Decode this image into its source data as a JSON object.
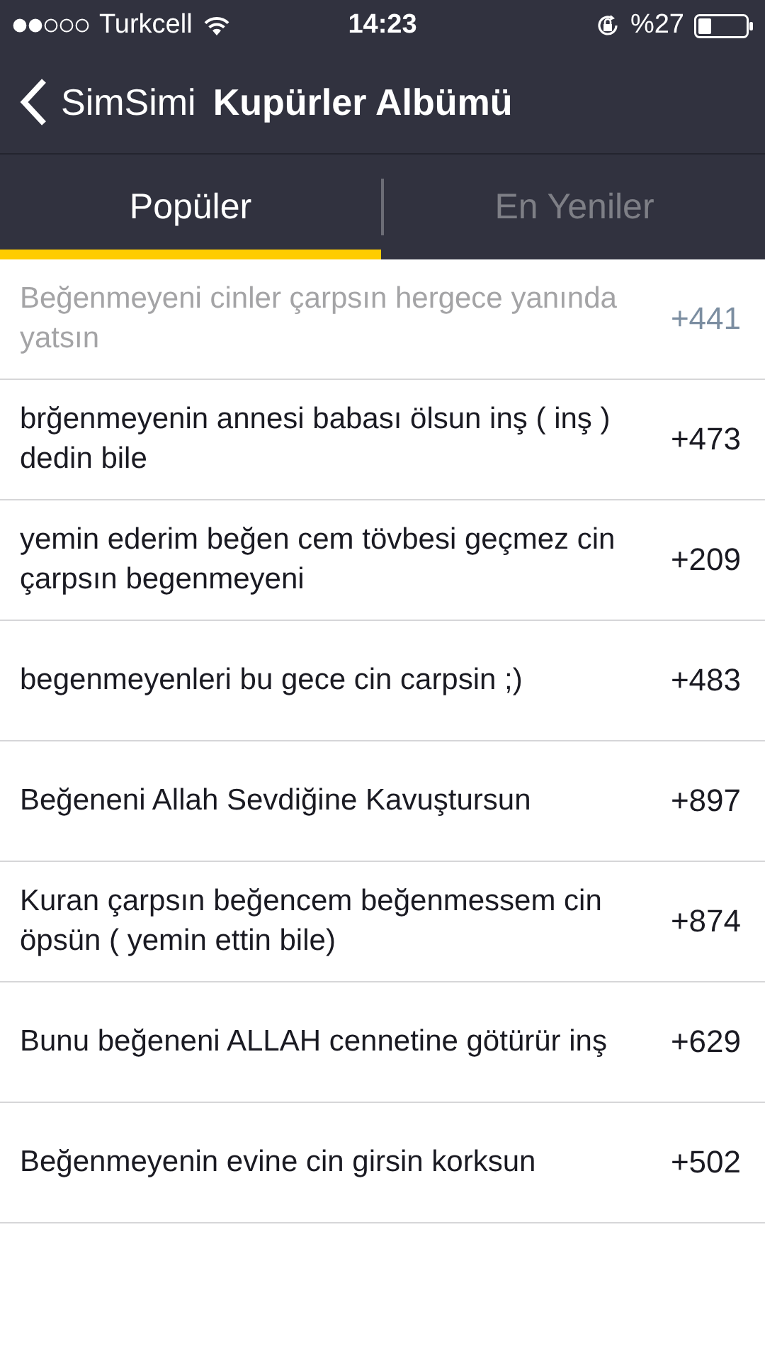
{
  "status_bar": {
    "carrier": "Turkcell",
    "time": "14:23",
    "battery": "%27"
  },
  "nav": {
    "back": "SimSimi",
    "title": "Kupürler Albümü"
  },
  "tabs": [
    {
      "label": "Popüler",
      "selected": true
    },
    {
      "label": "En Yeniler",
      "selected": false
    }
  ],
  "rows": [
    {
      "text": "Beğenmeyeni cinler çarpsın hergece yanında yatsın",
      "score": "+441",
      "disabled": true
    },
    {
      "text": "brğenmeyenin annesi babası ölsun inş ( inş ) dedin bile",
      "score": "+473",
      "disabled": false
    },
    {
      "text": "yemin ederim beğen cem tövbesi geçmez cin çarpsın begenmeyeni",
      "score": "+209",
      "disabled": false
    },
    {
      "text": "begenmeyenleri bu gece cin carpsin ;)",
      "score": "+483",
      "disabled": false
    },
    {
      "text": "Beğeneni Allah Sevdiğine Kavuştursun",
      "score": "+897",
      "disabled": false
    },
    {
      "text": "Kuran çarpsın beğencem beğenmessem cin öpsün ( yemin ettin bile)",
      "score": "+874",
      "disabled": false
    },
    {
      "text": "Bunu beğeneni ALLAH cennetine götürür inş",
      "score": "+629",
      "disabled": false
    },
    {
      "text": "Beğenmeyenin evine cin girsin korksun",
      "score": "+502",
      "disabled": false
    }
  ]
}
